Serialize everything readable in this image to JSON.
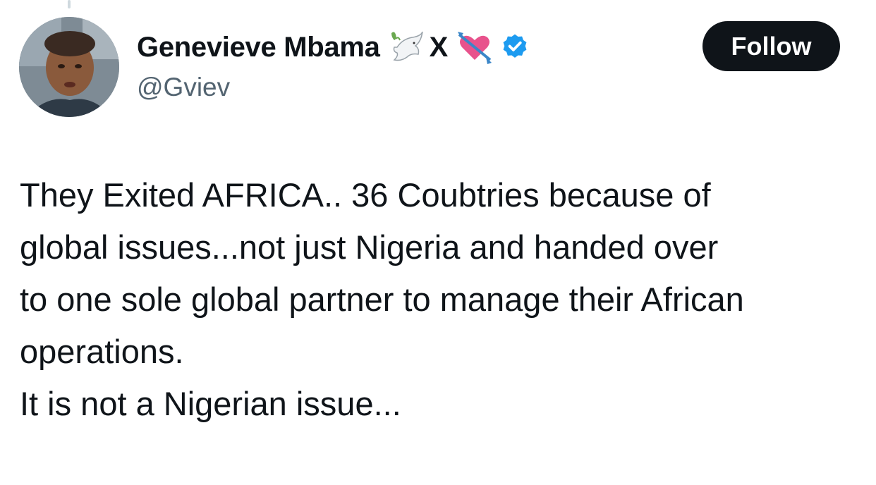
{
  "tweet": {
    "author": {
      "display_name": "Genevieve Mbama",
      "name_suffix": "X",
      "handle": "@Gviev",
      "verified": true,
      "emojis": [
        "dove-emoji",
        "heart-with-arrow-emoji"
      ]
    },
    "follow_label": "Follow",
    "text_lines": [
      "They Exited AFRICA.. 36 Coubtries because of",
      "global issues...not just Nigeria and handed over",
      "to one sole global partner to manage their African",
      "operations.",
      "It is not a Nigerian issue..."
    ]
  },
  "colors": {
    "text": "#0f1419",
    "secondary_text": "#536471",
    "verified_badge": "#1d9bf0",
    "follow_button_bg": "#0f1419",
    "follow_button_text": "#ffffff"
  }
}
